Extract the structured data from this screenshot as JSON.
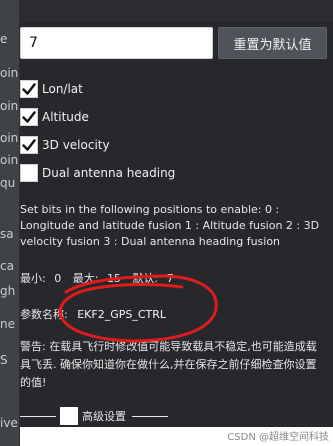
{
  "sidebar_fragments": [
    {
      "text": "e"
    },
    {
      "text": "oin"
    },
    {
      "text": "oin"
    },
    {
      "text": "oin"
    },
    {
      "text": "oin"
    },
    {
      "text": "qu"
    },
    {
      "text": "sa"
    },
    {
      "text": "ca"
    },
    {
      "text": "gh"
    },
    {
      "text": "ne"
    },
    {
      "text": "S"
    },
    {
      "text": "ive"
    }
  ],
  "value_input": {
    "value": "7"
  },
  "reset_button": {
    "label": "重置为默认值"
  },
  "bit_options": [
    {
      "label": "Lon/lat",
      "checked": true
    },
    {
      "label": "Altitude",
      "checked": true
    },
    {
      "label": "3D velocity",
      "checked": true
    },
    {
      "label": "Dual antenna heading",
      "checked": false
    }
  ],
  "description": "Set bits in the following positions to enable: 0 : Longitude and latitude fusion 1 : Altitude fusion 2 : 3D velocity fusion 3 : Dual antenna heading fusion",
  "range": {
    "min_label": "最小:",
    "min_value": "0",
    "max_label": "最大:",
    "max_value": "15",
    "default_label": "默认:",
    "default_value": "7"
  },
  "param": {
    "label": "参数名称:",
    "name": "EKF2_GPS_CTRL"
  },
  "warning": "警告: 在载具飞行时修改值可能导致载具不稳定,也可能造成载具飞丢. 确保你知道你在做什么,并在保存之前仔细检查你设置的值!",
  "advanced": {
    "label": "高级设置"
  },
  "watermark": "CSDN @超维空间科技",
  "colors": {
    "panel_bg": "#26282c",
    "annotation_red": "#e11b1b"
  }
}
